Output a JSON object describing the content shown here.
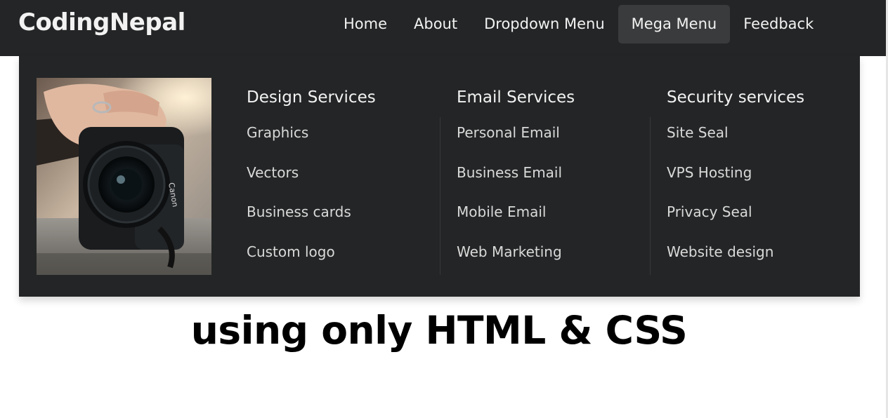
{
  "brand": {
    "logo": "CodingNepal"
  },
  "nav": {
    "items": [
      {
        "label": "Home",
        "active": false
      },
      {
        "label": "About",
        "active": false
      },
      {
        "label": "Dropdown Menu",
        "active": false
      },
      {
        "label": "Mega Menu",
        "active": true
      },
      {
        "label": "Feedback",
        "active": false
      }
    ]
  },
  "mega_menu": {
    "image": "camera-photo",
    "columns": [
      {
        "heading": "Design Services",
        "links": [
          "Graphics",
          "Vectors",
          "Business cards",
          "Custom logo"
        ]
      },
      {
        "heading": "Email Services",
        "links": [
          "Personal Email",
          "Business Email",
          "Mobile Email",
          "Web Marketing"
        ]
      },
      {
        "heading": "Security services",
        "links": [
          "Site Seal",
          "VPS Hosting",
          "Privacy Seal",
          "Website design"
        ]
      }
    ]
  },
  "hero": {
    "text": "using only HTML & CSS"
  },
  "colors": {
    "nav_bg": "#242526",
    "active_bg": "#3a3b3c",
    "text": "#f2f2f2",
    "link_text": "#d9d9d9"
  }
}
